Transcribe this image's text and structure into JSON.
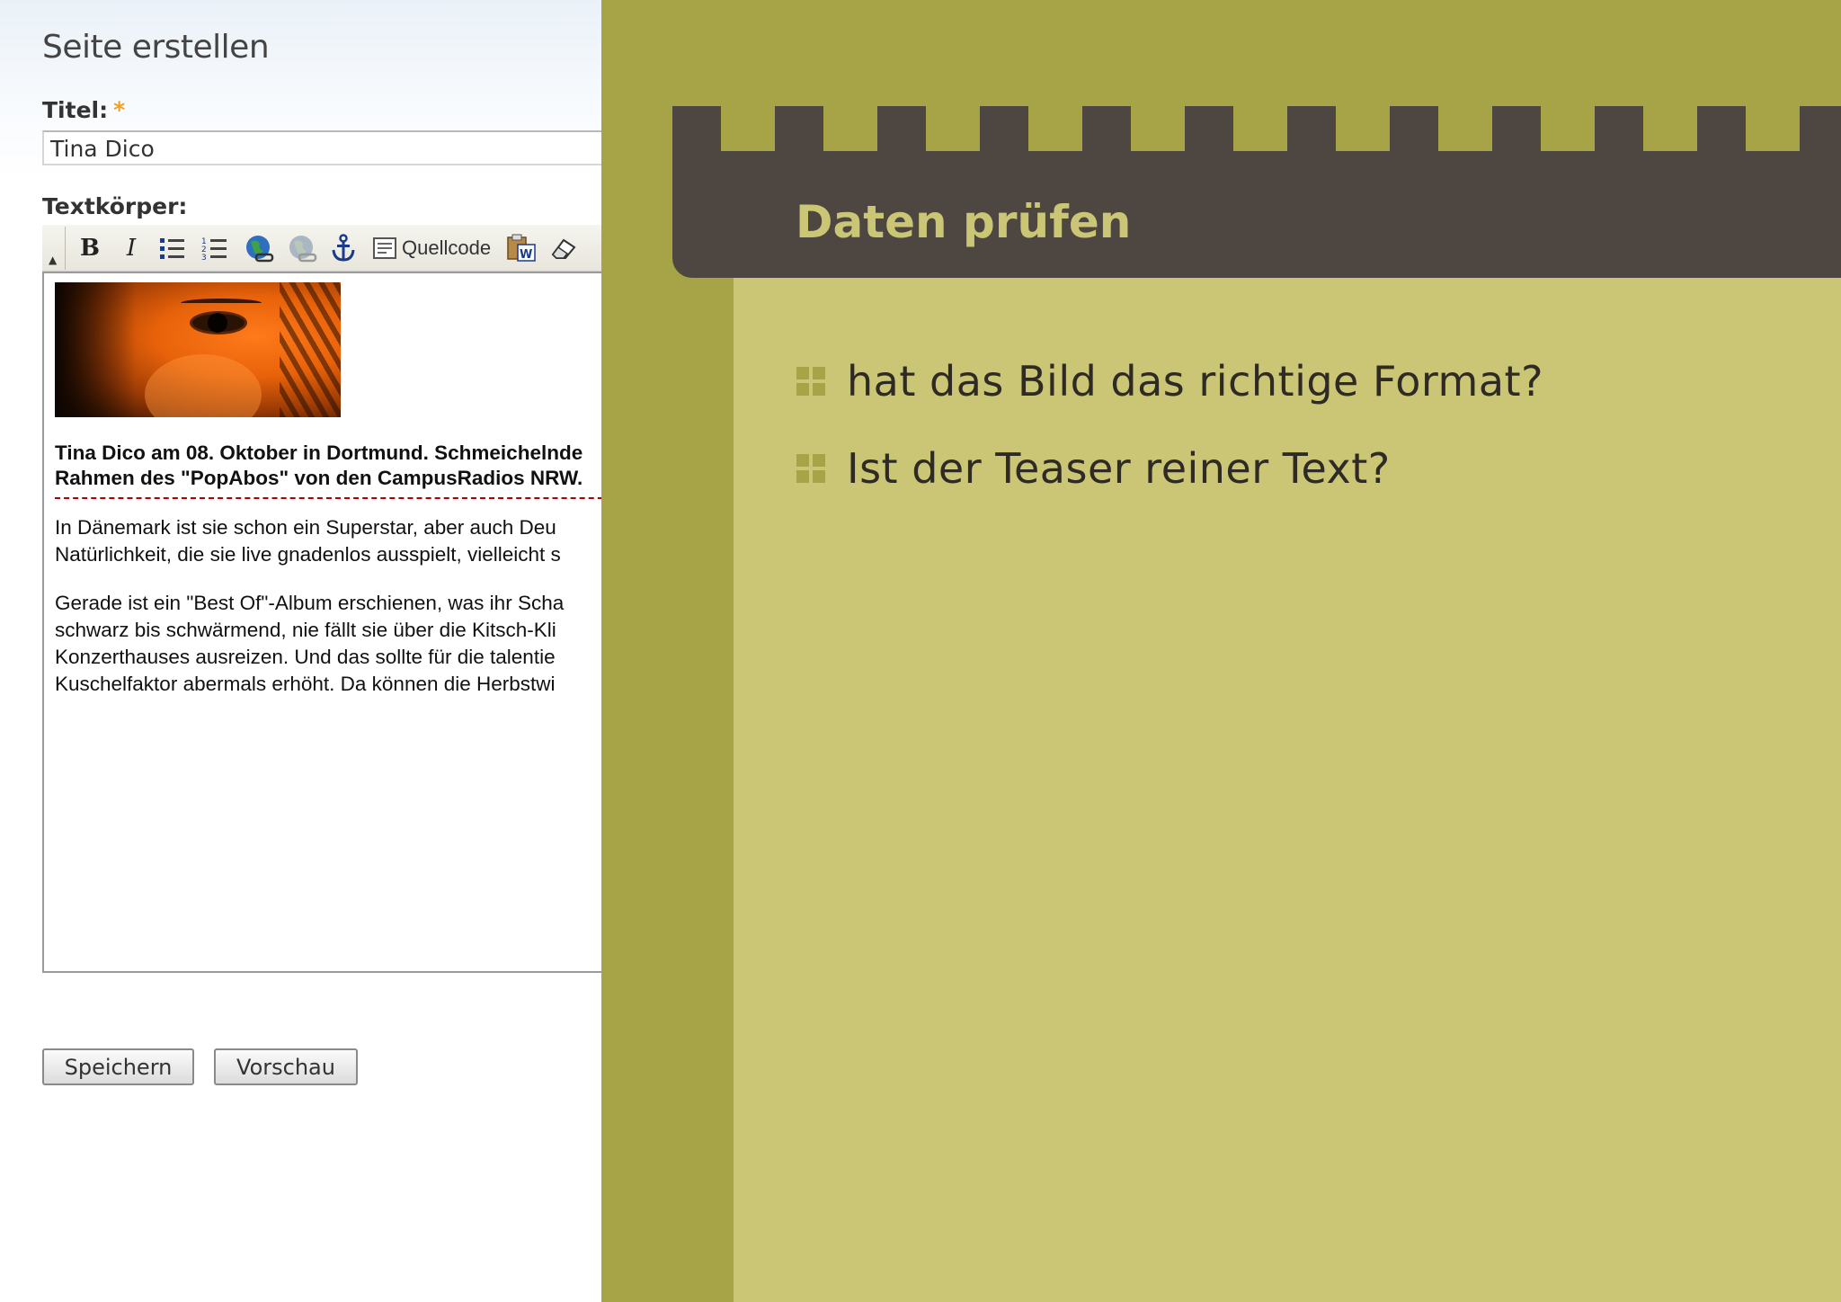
{
  "form": {
    "page_title": "Seite erstellen",
    "title_label": "Titel:",
    "required_mark": "*",
    "title_value": "Tina Dico",
    "body_label": "Textkörper:",
    "toolbar": {
      "bold": "B",
      "italic": "I",
      "bulleted_list_icon": "bulleted-list-icon",
      "numbered_list_icon": "numbered-list-icon",
      "link_icon": "link-globe-icon",
      "unlink_icon": "unlink-globe-icon",
      "anchor_icon": "anchor-icon",
      "source_label": "Quellcode",
      "paste_word_icon": "paste-from-word-icon",
      "eraser_icon": "remove-format-icon"
    },
    "editor": {
      "image_alt": "Tina Dico eye close-up",
      "teaser_line1": "Tina Dico am 08. Oktober in Dortmund. Schmeichelnde",
      "teaser_line2": "Rahmen des \"PopAbos\" von den CampusRadios NRW.",
      "para1_line1": "In Dänemark ist sie schon ein Superstar, aber auch Deu",
      "para1_line2": "Natürlichkeit, die sie live gnadenlos ausspielt, vielleicht s",
      "para2_line1": "Gerade ist ein \"Best Of\"-Album erschienen, was ihr Scha",
      "para2_line2": "schwarz bis schwärmend, nie fällt sie über die Kitsch-Kli",
      "para2_line3": "Konzerthauses ausreizen. Und das sollte für die talentie",
      "para2_line4": "Kuschelfaktor abermals erhöht. Da können die Herbstwi"
    },
    "buttons": {
      "save": "Speichern",
      "preview": "Vorschau"
    }
  },
  "slide": {
    "title": "Daten prüfen",
    "items": [
      {
        "text": "hat das Bild das richtige Format?"
      },
      {
        "text": "Ist der Teaser reiner Text?"
      }
    ],
    "colors": {
      "olive": "#a6a447",
      "panel": "#cac675",
      "header": "#4d4641",
      "text": "#2f2a24"
    }
  }
}
